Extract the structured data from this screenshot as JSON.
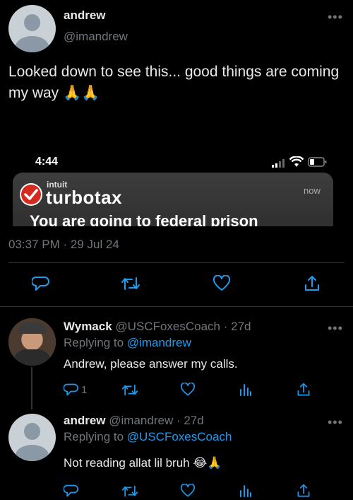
{
  "main_tweet": {
    "display_name": "andrew",
    "handle": "@imandrew",
    "text": "Looked down to see this... good things are coming my way",
    "emoji": "🙏🙏",
    "timestamp": "03:37 PM · 29 Jul 24"
  },
  "embedded_screenshot": {
    "time": "4:44",
    "brand_small": "intuit",
    "brand": "turbotax",
    "notif_time": "now",
    "notif_text": "You are going to federal prison"
  },
  "replies": [
    {
      "display_name": "Wymack",
      "handle": "@USCFoxesCoach",
      "age": "· 27d",
      "replying_prefix": "Replying to",
      "replying_to": "@imandrew",
      "text": "Andrew, please answer my calls.",
      "reply_count": "1"
    },
    {
      "display_name": "andrew",
      "handle": "@imandrew",
      "age": "· 27d",
      "replying_prefix": "Replying to",
      "replying_to": "@USCFoxesCoach",
      "text": "Not reading allat lil bruh",
      "emoji": "😂🙏"
    }
  ],
  "icons": [
    "more-icon",
    "reply-icon",
    "retweet-icon",
    "like-icon",
    "share-icon",
    "views-icon"
  ],
  "colors": {
    "background": "#000000",
    "text": "#e7e9ea",
    "muted": "#71767b",
    "link": "#1d9bf0",
    "divider": "#2f3336"
  }
}
